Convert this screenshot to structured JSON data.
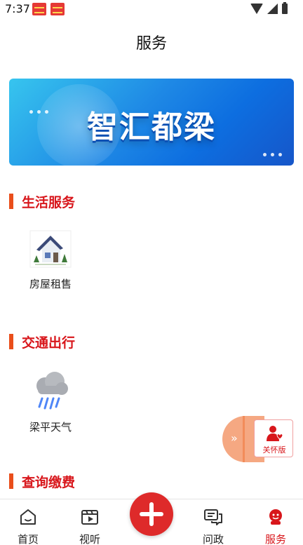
{
  "status_bar": {
    "time": "7:37"
  },
  "header": {
    "title": "服务"
  },
  "banner": {
    "text": "智汇都梁"
  },
  "sections": [
    {
      "title": "生活服务",
      "items": [
        {
          "label": "房屋租售",
          "icon": "house-icon"
        }
      ]
    },
    {
      "title": "交通出行",
      "items": [
        {
          "label": "梁平天气",
          "icon": "rain-cloud-icon"
        }
      ]
    },
    {
      "title": "查询缴费",
      "items": []
    }
  ],
  "floating": {
    "arrow": "»",
    "care_label": "关怀版"
  },
  "bottom_nav": [
    {
      "label": "首页",
      "icon": "home-icon"
    },
    {
      "label": "视听",
      "icon": "video-icon"
    },
    {
      "label": "问政",
      "icon": "chat-icon"
    },
    {
      "label": "服务",
      "icon": "service-icon",
      "active": true
    }
  ],
  "colors": {
    "accent_red": "#d8161b",
    "section_bar": "#e94e1b",
    "center_button": "#de2a2a"
  }
}
